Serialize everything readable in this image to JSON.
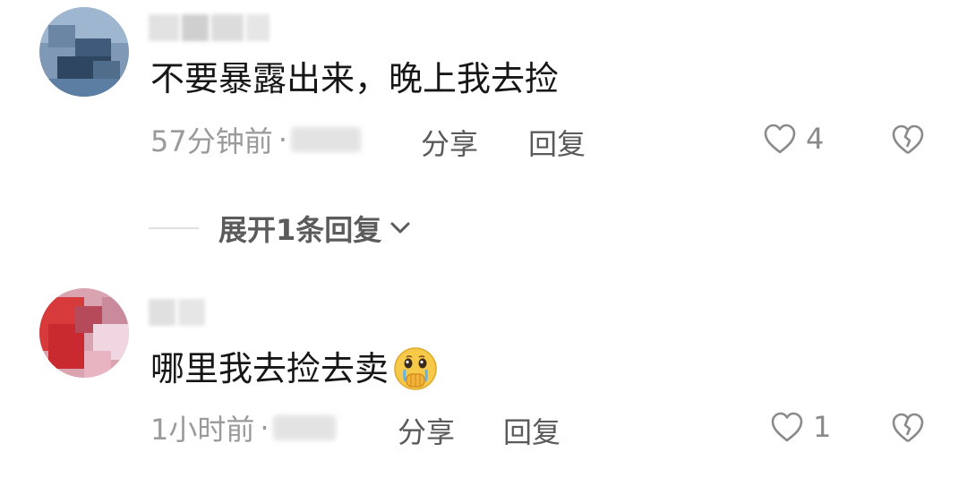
{
  "comments": [
    {
      "text": "不要暴露出来，晚上我去捡",
      "time": "57分钟前",
      "separator": "·",
      "share": "分享",
      "reply": "回复",
      "likes": "4",
      "expand_replies": "展开1条回复"
    },
    {
      "text": "哪里我去捡去卖",
      "emoji": "crying-face-covering-mouth-emoji",
      "time": "1小时前",
      "separator": "·",
      "share": "分享",
      "reply": "回复",
      "likes": "1"
    }
  ],
  "colors": {
    "text_primary": "#161616",
    "text_meta": "#9a9a9a",
    "icon_gray": "#8a8a8a"
  }
}
